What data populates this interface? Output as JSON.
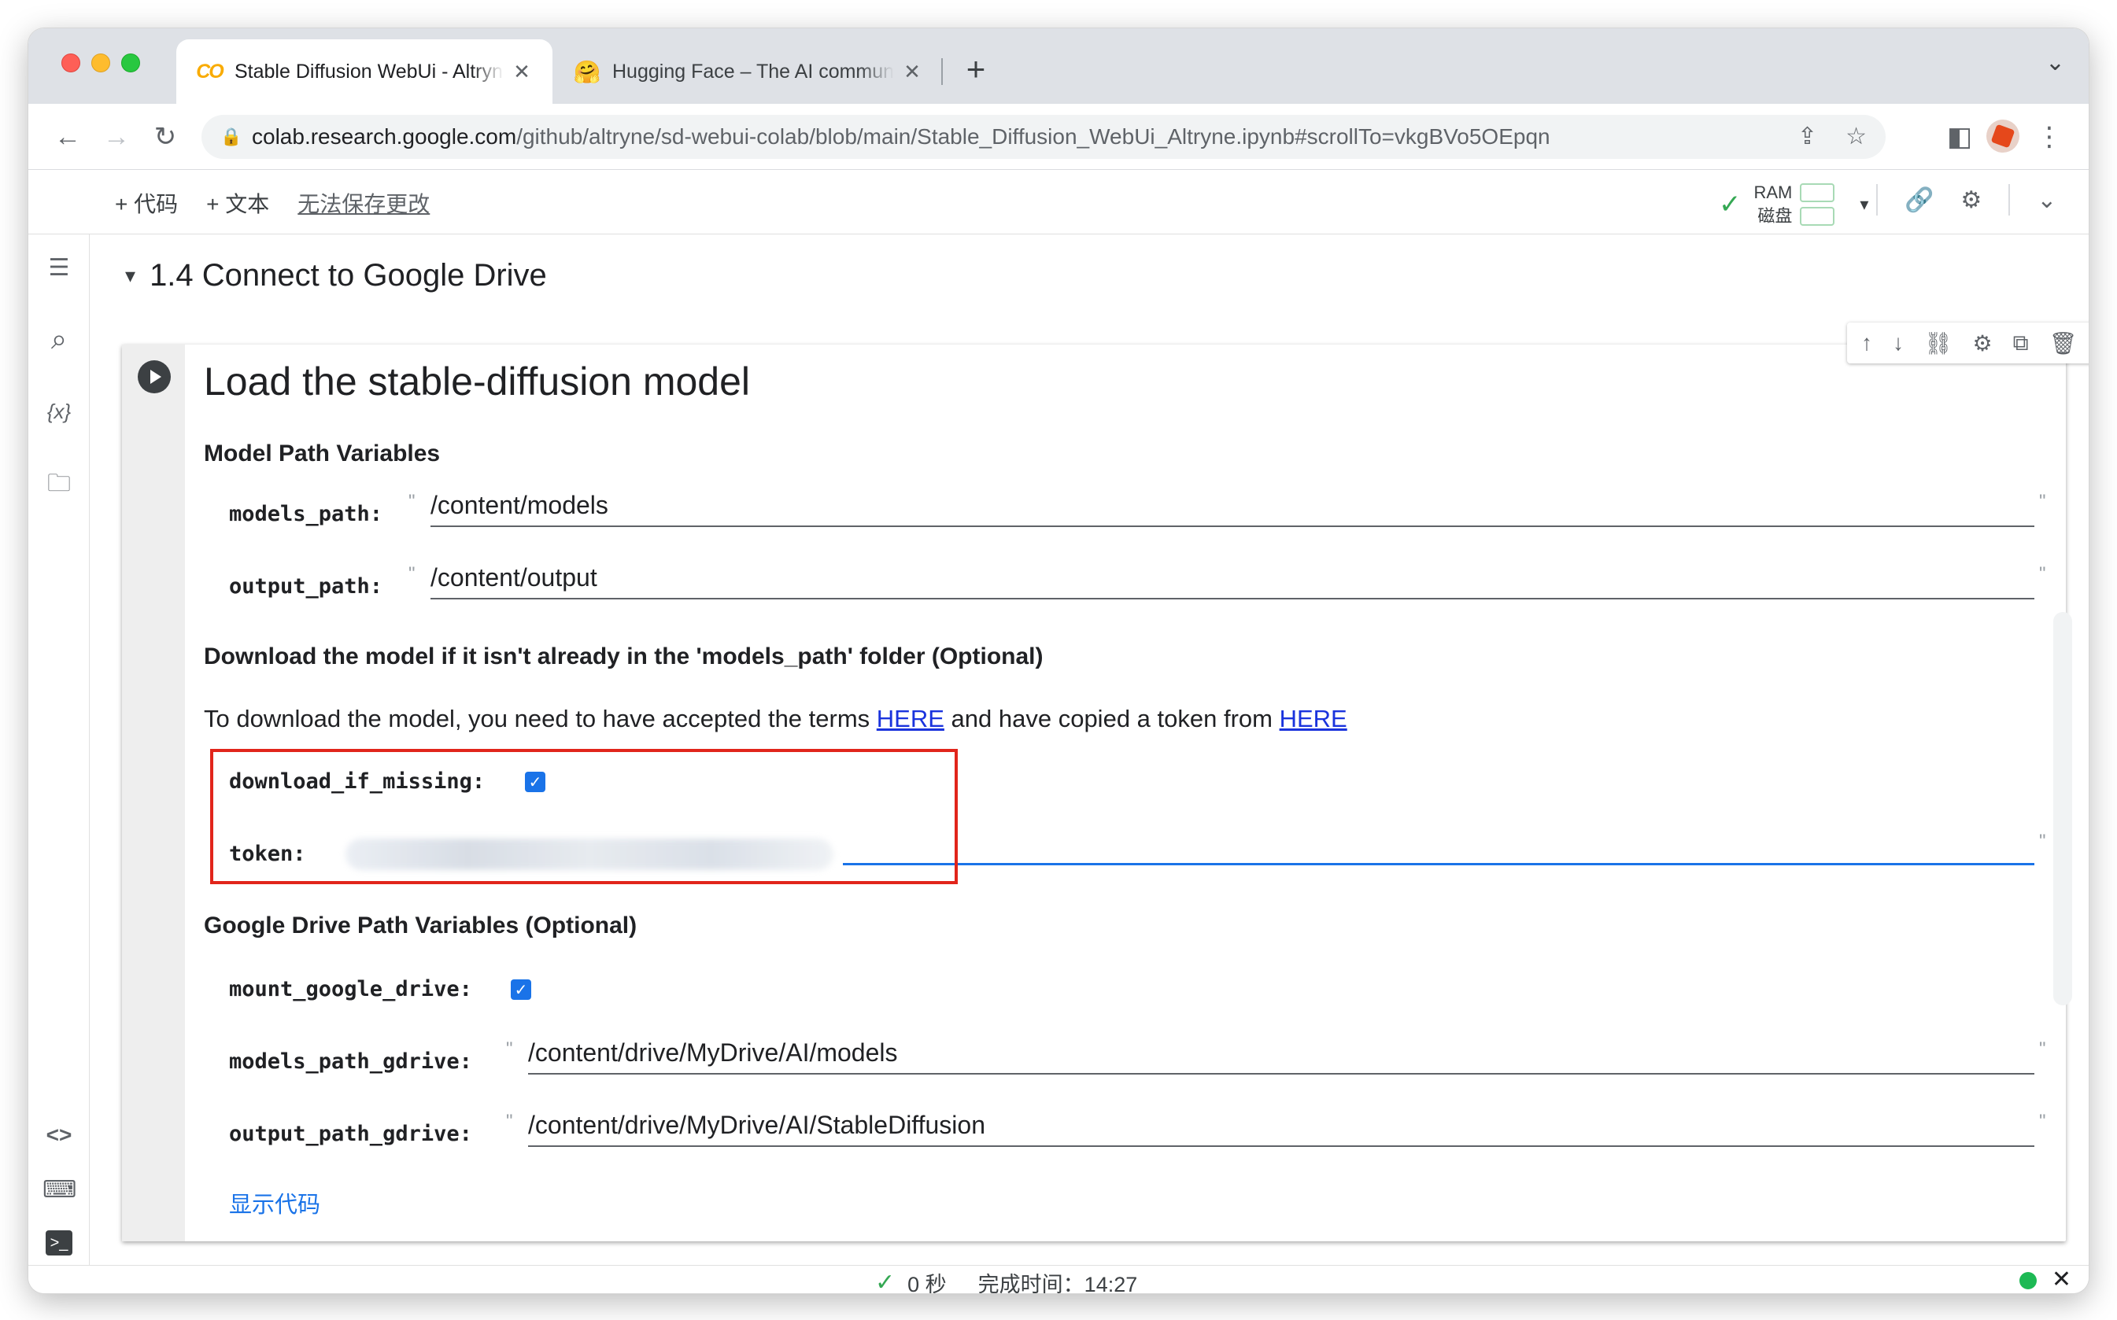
{
  "browser": {
    "tabs": [
      {
        "title": "Stable Diffusion WebUi - Altryne",
        "favicon": "colab-logo",
        "active": true
      },
      {
        "title": "Hugging Face – The AI community",
        "favicon": "hugging-face-emoji",
        "active": false
      }
    ],
    "favicon_colab_text": "CO",
    "favicon_hf_glyph": "🤗",
    "close_glyph": "✕",
    "new_tab_glyph": "+",
    "tab_menu_glyph": "⌄",
    "url_host": "colab.research.google.com",
    "url_path": "/github/altryne/sd-webui-colab/blob/main/Stable_Diffusion_WebUi_Altryne.ipynb#scrollTo=vkgBVo5OEpqn",
    "back_glyph": "←",
    "forward_glyph": "→",
    "reload_glyph": "↻",
    "lock_glyph": "🔒",
    "share_glyph": "⇪",
    "star_glyph": "☆",
    "sidepanel_glyph": "◧",
    "menu_glyph": "⋮"
  },
  "colab": {
    "add_code": "+ 代码",
    "add_text": "+ 文本",
    "unsaved": "无法保存更改",
    "ram_label": "RAM",
    "disk_label": "磁盘",
    "connected_glyph": "✓",
    "dropdown_glyph": "▾",
    "link_glyph": "🔗",
    "settings_glyph": "⚙",
    "collapse_glyph": "⌄"
  },
  "rail": {
    "toc_glyph": "☰",
    "search_glyph": "⌕",
    "variables_glyph": "{x}",
    "files_glyph": "🗀",
    "code_snippets_glyph": "<>",
    "command_palette_glyph": "⌨",
    "terminal_glyph": ">_"
  },
  "notebook": {
    "section_caret": "▾",
    "section_title": "1.4 Connect to Google Drive",
    "cell_toolbar": {
      "up": "↑",
      "down": "↓",
      "link": "⛓",
      "settings": "⚙",
      "mirror": "⧉",
      "delete": "🗑",
      "more": "⋮"
    },
    "cell": {
      "title": "Load the stable-diffusion model",
      "model_path_heading": "Model Path Variables",
      "models_path_label": "models_path:",
      "models_path_value": "/content/models",
      "output_path_label": "output_path:",
      "output_path_value": "/content/output",
      "download_heading": "Download the model if it isn't already in the 'models_path' folder (Optional)",
      "download_text_1": "To download the model, you need to have accepted the terms ",
      "download_link_1": "HERE",
      "download_text_2": " and have copied a token from ",
      "download_link_2": "HERE",
      "download_if_missing_label": "download_if_missing:",
      "download_if_missing_checked": true,
      "token_label": "token:",
      "gdrive_heading": "Google Drive Path Variables (Optional)",
      "mount_google_drive_label": "mount_google_drive:",
      "mount_google_drive_checked": true,
      "models_path_gdrive_label": "models_path_gdrive:",
      "models_path_gdrive_value": "/content/drive/MyDrive/AI/models",
      "output_path_gdrive_label": "output_path_gdrive:",
      "output_path_gdrive_value": "/content/drive/MyDrive/AI/StableDiffusion",
      "show_code": "显示代码",
      "quote": "\"",
      "check_glyph": "✓"
    }
  },
  "status": {
    "check_glyph": "✓",
    "duration": "0 秒",
    "completed": "完成时间：14:27",
    "close_glyph": "✕",
    "status_color": "#1db954"
  }
}
